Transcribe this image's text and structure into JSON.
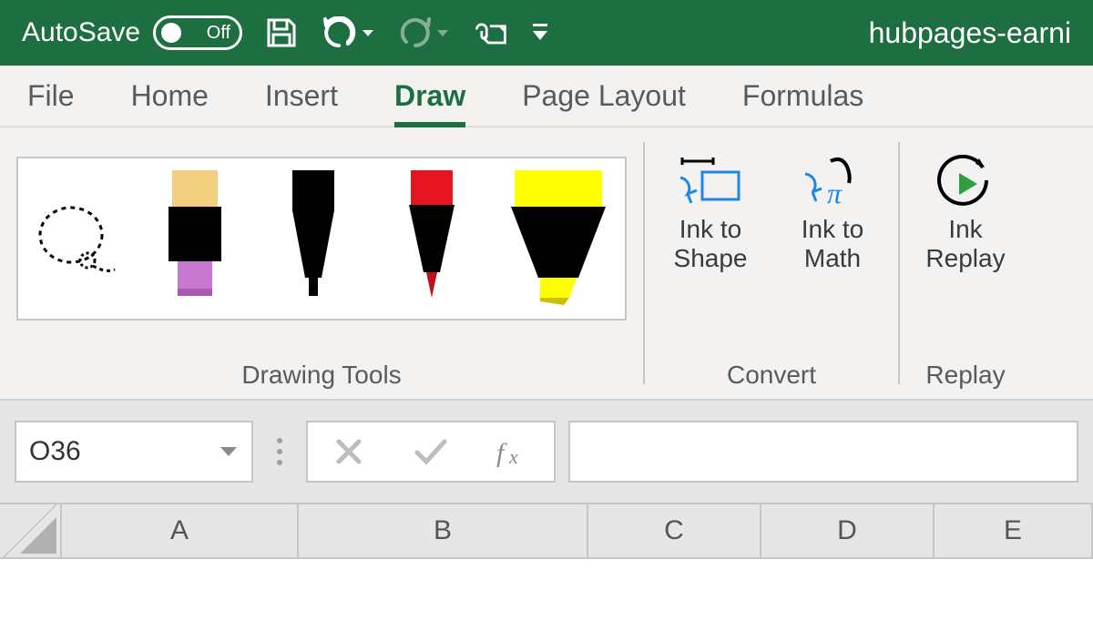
{
  "titlebar": {
    "autosave_label": "AutoSave",
    "autosave_state": "Off",
    "document_name": "hubpages-earni"
  },
  "tabs": {
    "file": "File",
    "home": "Home",
    "insert": "Insert",
    "draw": "Draw",
    "page_layout": "Page Layout",
    "formulas": "Formulas"
  },
  "ribbon": {
    "drawing_tools_label": "Drawing Tools",
    "convert": {
      "label": "Convert",
      "ink_to_shape": "Ink to Shape",
      "ink_to_math": "Ink to Math"
    },
    "replay": {
      "label": "Replay",
      "ink_replay": "Ink Replay"
    }
  },
  "formula_bar": {
    "name_box_value": "O36",
    "formula_value": ""
  },
  "columns": {
    "A": "A",
    "B": "B",
    "C": "C",
    "D": "D",
    "E": "E"
  }
}
